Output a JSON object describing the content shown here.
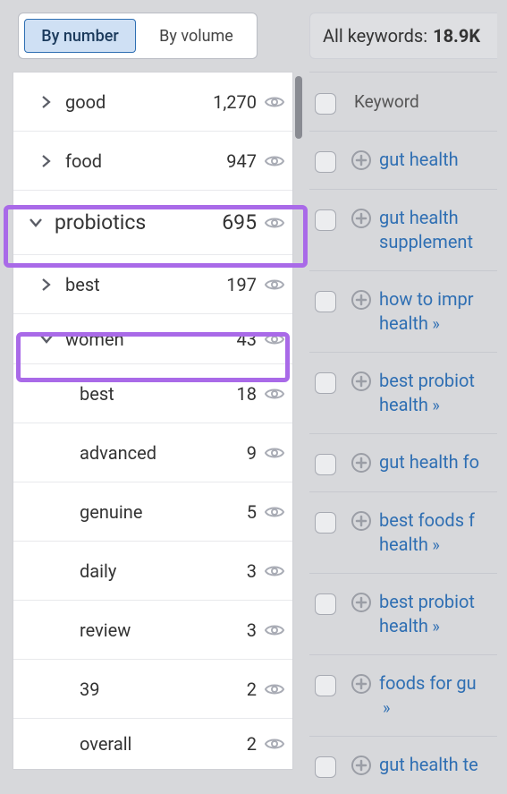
{
  "tabs": {
    "by_number": "By number",
    "by_volume": "By volume"
  },
  "tree": {
    "good": {
      "label": "good",
      "count": "1,270"
    },
    "food": {
      "label": "food",
      "count": "947"
    },
    "probiotics": {
      "label": "probiotics",
      "count": "695"
    },
    "best": {
      "label": "best",
      "count": "197"
    },
    "women": {
      "label": "women",
      "count": "43"
    },
    "sub": {
      "best": {
        "label": "best",
        "count": "18"
      },
      "advanced": {
        "label": "advanced",
        "count": "9"
      },
      "genuine": {
        "label": "genuine",
        "count": "5"
      },
      "daily": {
        "label": "daily",
        "count": "3"
      },
      "review": {
        "label": "review",
        "count": "3"
      },
      "n39": {
        "label": "39",
        "count": "2"
      },
      "overall": {
        "label": "overall",
        "count": "2"
      }
    }
  },
  "right": {
    "all_label": "All keywords:",
    "all_value": "18.9K",
    "th_keyword": "Keyword",
    "rows": {
      "0": "gut health",
      "1": "gut health supplement",
      "2": "how to impr health",
      "3": "best probiot health",
      "4": "gut health fo",
      "5": "best foods f health",
      "6": "best probiot health",
      "7": "foods for gu",
      "8": "gut health te"
    }
  }
}
